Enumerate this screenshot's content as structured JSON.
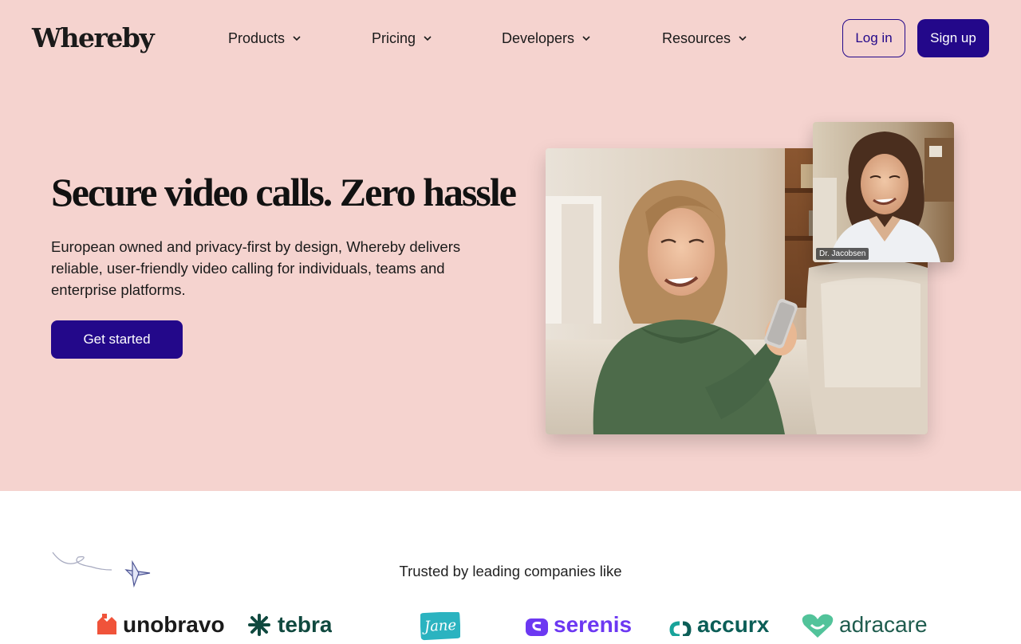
{
  "header": {
    "logo": "Whereby",
    "nav": [
      {
        "label": "Products"
      },
      {
        "label": "Pricing"
      },
      {
        "label": "Developers"
      },
      {
        "label": "Resources"
      }
    ],
    "login_label": "Log in",
    "signup_label": "Sign up"
  },
  "hero": {
    "title": "Secure video calls. Zero hassle",
    "description": "European owned and privacy-first by design, Whereby delivers reliable, user-friendly video calling for individuals, teams and enterprise platforms.",
    "cta_label": "Get started",
    "pip_name": "Dr. Jacobsen"
  },
  "trusted": {
    "heading": "Trusted by leading companies like",
    "logos": [
      {
        "name": "unobravo",
        "color": "#1a1a1a",
        "accent": "#f0533a"
      },
      {
        "name": "tebra",
        "color": "#10493f",
        "accent": "#10493f"
      },
      {
        "name": "Jane",
        "color": "#ffffff",
        "accent": "#2bb3c0"
      },
      {
        "name": "serenis",
        "color": "#6c38f2",
        "accent": "#6c38f2"
      },
      {
        "name": "accurx",
        "color": "#0c5e57",
        "accent": "#18a39a"
      },
      {
        "name": "adracare",
        "color": "#1f5c4e",
        "accent": "#52c39a"
      }
    ]
  },
  "colors": {
    "hero_bg": "#f5d3cf",
    "brand": "#23088a"
  }
}
